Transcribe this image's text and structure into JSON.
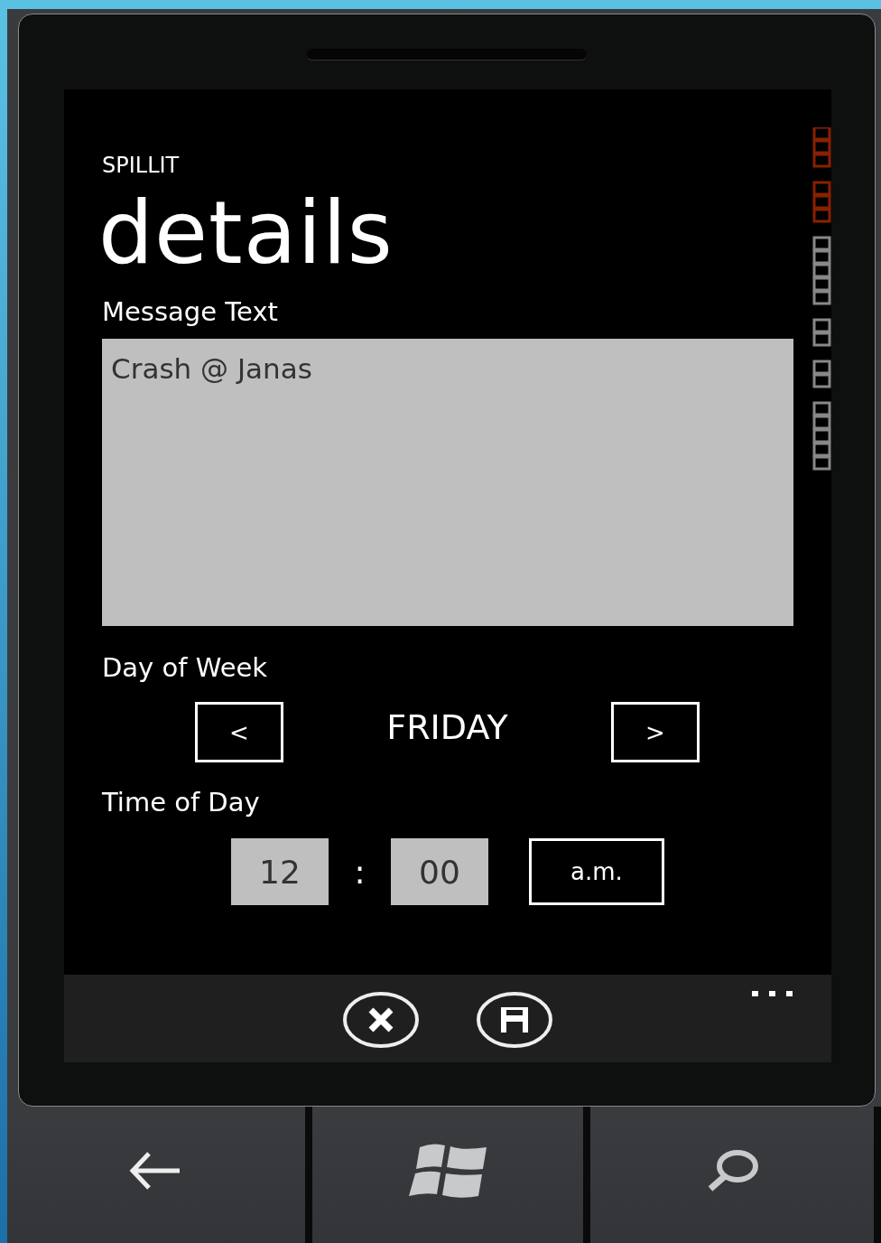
{
  "app_title": "SPILLIT",
  "page_title": "details",
  "message": {
    "label": "Message Text",
    "value": "Crash @ Janas"
  },
  "day": {
    "label": "Day of Week",
    "prev": "<",
    "value": "FRIDAY",
    "next": ">"
  },
  "time": {
    "label": "Time of Day",
    "hour": "12",
    "separator": ":",
    "minute": "00",
    "period": "a.m."
  },
  "app_bar": {
    "buttons": [
      {
        "kind": "cancel"
      },
      {
        "kind": "save"
      }
    ]
  },
  "nav_buttons": [
    {
      "kind": "back"
    },
    {
      "kind": "start"
    },
    {
      "kind": "search"
    }
  ]
}
